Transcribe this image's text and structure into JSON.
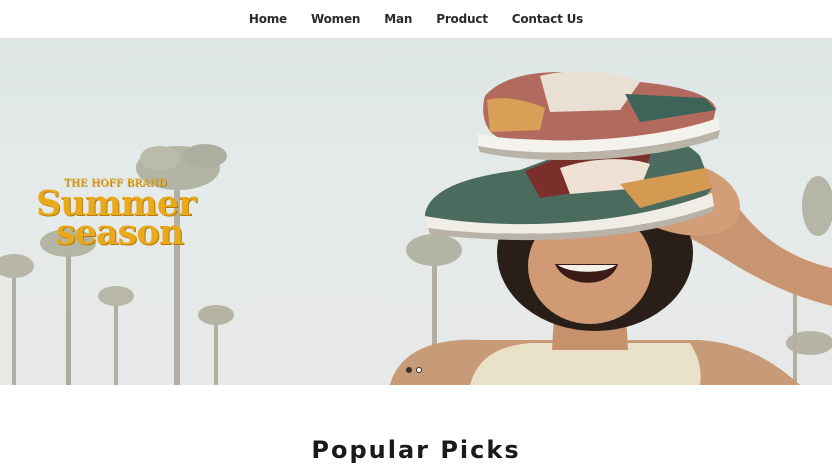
{
  "nav": {
    "items": [
      {
        "label": "Home"
      },
      {
        "label": "Women"
      },
      {
        "label": "Man"
      },
      {
        "label": "Product"
      },
      {
        "label": "Contact Us"
      }
    ]
  },
  "hero": {
    "brand_small": "THE HOFF BRAND",
    "brand_line1": "Summer",
    "brand_line2": "season",
    "slides_total": 2,
    "slide_active": 1,
    "brand_color": "#e8a91c"
  },
  "section": {
    "title": "Popular Picks"
  }
}
